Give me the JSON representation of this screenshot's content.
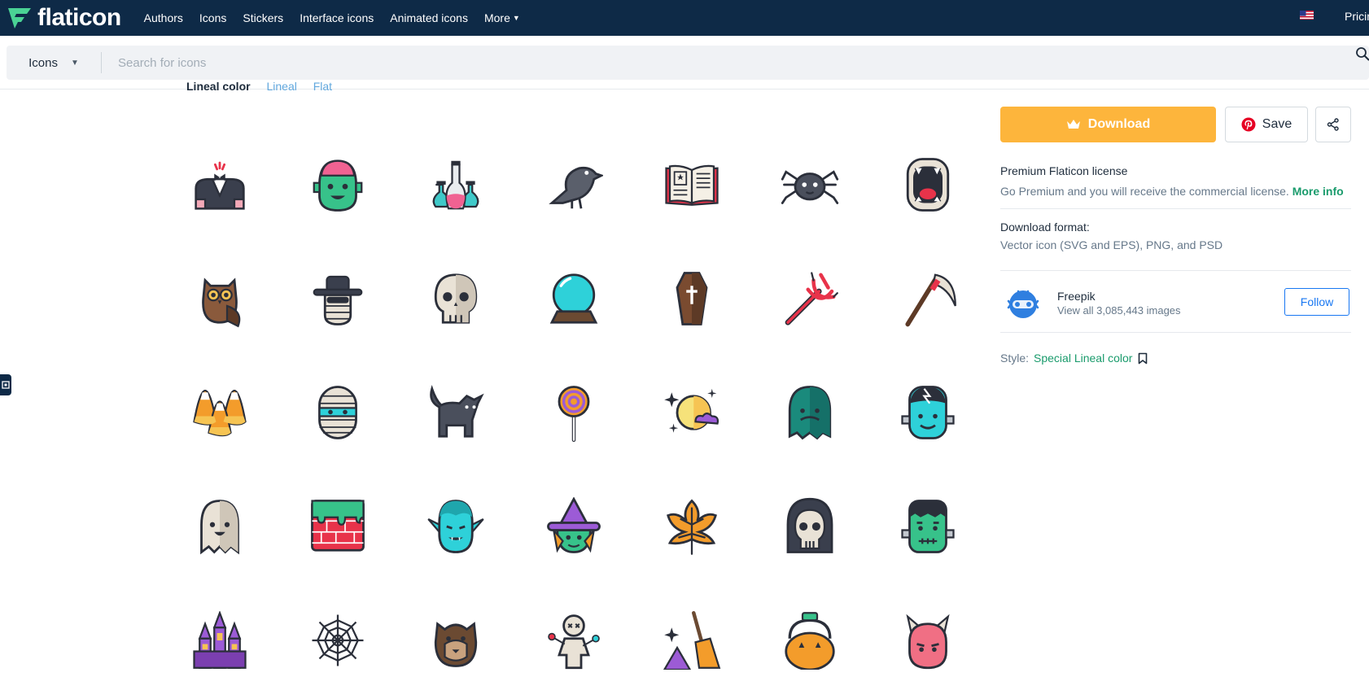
{
  "nav": {
    "logo_text": "flaticon",
    "links": [
      {
        "label": "Authors"
      },
      {
        "label": "Icons"
      },
      {
        "label": "Stickers"
      },
      {
        "label": "Interface icons"
      },
      {
        "label": "Animated icons"
      },
      {
        "label": "More"
      }
    ],
    "pricing": "Pricing",
    "flag": "us-flag-icon",
    "brand_color": "#0e2a47"
  },
  "search": {
    "type_label": "Icons",
    "placeholder": "Search for icons",
    "value": ""
  },
  "style_tabs": {
    "current": "Lineal color",
    "others": [
      "Lineal",
      "Flat"
    ]
  },
  "icons": [
    {
      "name": "vampire-suit"
    },
    {
      "name": "zombie"
    },
    {
      "name": "potions"
    },
    {
      "name": "crow"
    },
    {
      "name": "spell-book"
    },
    {
      "name": "spider"
    },
    {
      "name": "monster-mouth"
    },
    {
      "name": "owl"
    },
    {
      "name": "invisible-man"
    },
    {
      "name": "skull"
    },
    {
      "name": "crystal-ball"
    },
    {
      "name": "coffin"
    },
    {
      "name": "trident"
    },
    {
      "name": "scythe"
    },
    {
      "name": "candy-corn"
    },
    {
      "name": "mummy"
    },
    {
      "name": "black-cat"
    },
    {
      "name": "lollipop"
    },
    {
      "name": "moon-night"
    },
    {
      "name": "ghost-monster"
    },
    {
      "name": "frankenstein-bride"
    },
    {
      "name": "ghost"
    },
    {
      "name": "slime-wall"
    },
    {
      "name": "vampire"
    },
    {
      "name": "witch"
    },
    {
      "name": "autumn-leaf"
    },
    {
      "name": "grim-reaper"
    },
    {
      "name": "frankenstein"
    },
    {
      "name": "haunted-house"
    },
    {
      "name": "spider-web"
    },
    {
      "name": "werewolf"
    },
    {
      "name": "voodoo-doll"
    },
    {
      "name": "witch-broom"
    },
    {
      "name": "pumpkin-bucket"
    },
    {
      "name": "devil"
    }
  ],
  "panel": {
    "download_label": "Download",
    "save_label": "Save",
    "license_title": "Premium Flaticon license",
    "license_text": "Go Premium and you will receive the commercial license.",
    "license_link": "More info",
    "format_title": "Download format:",
    "format_text": "Vector icon (SVG and EPS), PNG, and PSD",
    "author_name": "Freepik",
    "author_sub": "View all 3,085,443 images",
    "follow_label": "Follow",
    "style_label": "Style:",
    "style_value": "Special Lineal color",
    "accent_download": "#fdb53c",
    "accent_link": "#1a9b6c",
    "accent_follow": "#1877f2"
  }
}
